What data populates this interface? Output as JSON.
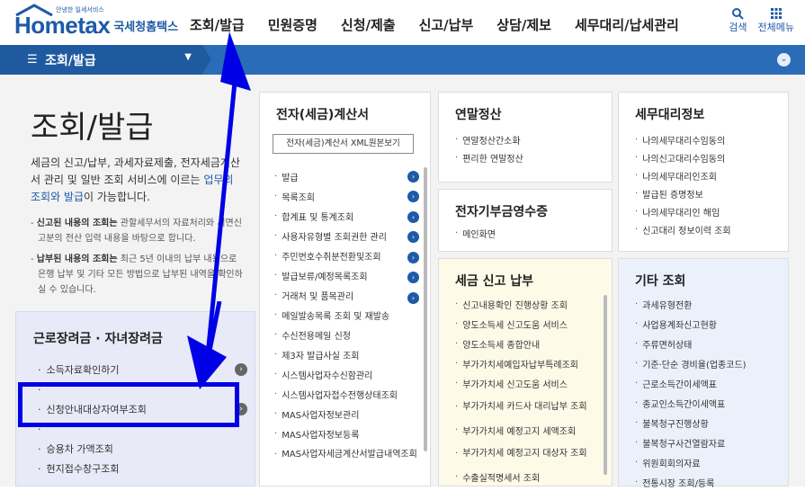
{
  "header": {
    "logo_small": "안녕한 일세서비스",
    "logo_main": "Hometax",
    "logo_kr": "국세청홈택스",
    "nav": [
      "조회/발급",
      "민원증명",
      "신청/제출",
      "신고/납부",
      "상담/제보",
      "세무대리/납세관리"
    ],
    "search_label": "검색",
    "allmenu_label": "전체메뉴"
  },
  "navbar": {
    "current": "조회/발급"
  },
  "left": {
    "title": "조회/발급",
    "desc_prefix": "세금의 신고/납부, 과세자료제출, 전자세금계산서 관리 및 일반 조회 서비스에 이르는 ",
    "desc_highlight": "업무의 조회와 발급",
    "desc_suffix": "이 가능합니다.",
    "note1_bold": "신고된 내용의 조회는",
    "note1_rest": " 관할세무서의 자료처리와 서면신고분의 전산 입력 내용을 바탕으로 합니다.",
    "note2_bold": "납부된 내용의 조회는",
    "note2_rest": " 최근 5년 이내의 납부 내용으로 은행 납부 및 기타 모든 방법으로 납부된 내역을 확인하실 수 있습니다."
  },
  "subsidy": {
    "title": "근로장려금 · 자녀장려금",
    "items": [
      "소득자료확인하기",
      "",
      "신청안내대상자여부조회",
      "",
      "승용차 가액조회",
      "현지접수창구조회"
    ]
  },
  "panels": {
    "etax": {
      "title": "전자(세금)계산서",
      "xml_button": "전자(세금)계산서 XML원본보기",
      "items": [
        "발급",
        "목록조회",
        "합계표 및 통계조회",
        "사용자유형별 조회권한 관리",
        "주민번호수취분전환및조회",
        "발급보류/예정목록조회",
        "거래처 및 품목관리",
        "메일발송목록 조회 및 재발송",
        "수신전용메일 신청",
        "제3자 발급사실 조회",
        "시스템사업자수신함관리",
        "시스템사업자접수전행상태조회",
        "MAS사업자정보관리",
        "MAS사업자정보등록",
        "MAS사업자세금계산서발급내역조회"
      ]
    },
    "yearend": {
      "title": "연말정산",
      "items": [
        "연말정산간소화",
        "편리한 연말정산"
      ]
    },
    "donation": {
      "title": "전자기부금영수증",
      "items": [
        "메인화면"
      ]
    },
    "taxfiling": {
      "title": "세금 신고 납부",
      "items": [
        "신고내용확인 진행상황 조회",
        "양도소득세 신고도움 서비스",
        "양도소득세 종합안내",
        "부가가치세예입자납부특례조회",
        "부가가치세 신고도움 서비스",
        "부가가치세 카드사 대리납부 조회",
        "부가가치세 예정고지 세액조회",
        "부가가치세 예정고지 대상자 조회",
        "수출실적명세서 조회"
      ]
    },
    "agent": {
      "title": "세무대리정보",
      "items": [
        "나의세무대리수임동의",
        "나의신고대리수임동의",
        "나의세무대리인조회",
        "발급된 증명정보",
        "나의세무대리인 해임",
        "신고대리 정보이력 조회"
      ]
    },
    "other": {
      "title": "기타 조회",
      "items": [
        "과세유형전환",
        "사업용계좌신고현황",
        "주류면허상태",
        "기준·단순 경비율(업종코드)",
        "근로소득간이세액표",
        "종교인소득간이세액표",
        "불복청구진행상황",
        "불복청구사건열람자료",
        "위원회회의자료",
        "전통시장 조회/등록"
      ]
    }
  },
  "colors": {
    "brand": "#1e5aa8",
    "navbar": "#2b6cb8",
    "annotation": "#0000e6"
  }
}
